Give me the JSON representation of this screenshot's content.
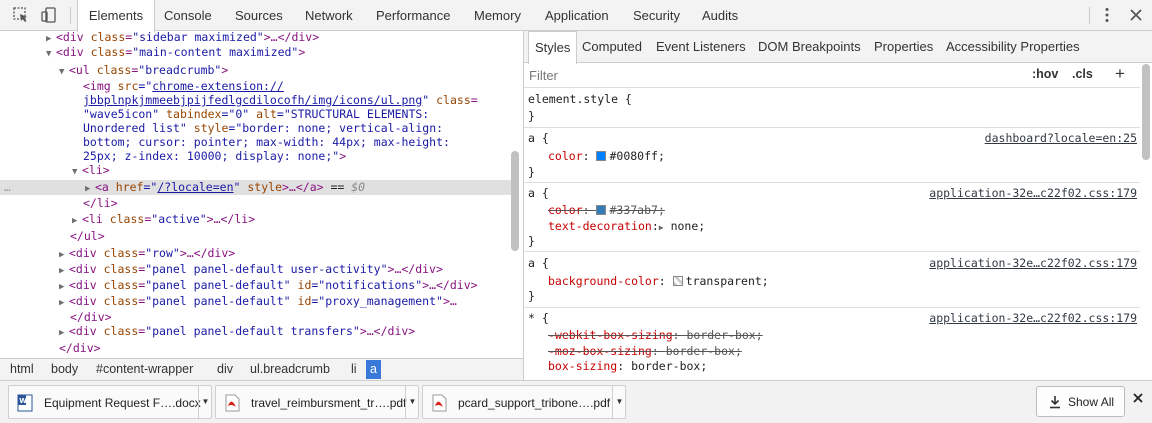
{
  "topbar": {
    "tabs": [
      "Elements",
      "Console",
      "Sources",
      "Network",
      "Performance",
      "Memory",
      "Application",
      "Security",
      "Audits"
    ],
    "active_tab": "Elements",
    "icons": [
      "inspect-element-icon",
      "device-toolbar-icon",
      "kebab-menu-icon",
      "close-icon"
    ]
  },
  "dom": {
    "l1": {
      "tag_open": "<div ",
      "attr": "class",
      "val": "\"sidebar maximized\"",
      "rest": ">…</div>"
    },
    "l2": {
      "tag_open": "<div ",
      "attr": "class",
      "val": "\"main-content maximized\"",
      "rest": ">"
    },
    "l3": {
      "tag_open": "<ul ",
      "attr": "class",
      "val": "\"breadcrumb\"",
      "rest": ">"
    },
    "l4": {
      "tag_open": "<img ",
      "attr": "src",
      "eq": "=\"",
      "link": "chrome-extension://"
    },
    "l5": {
      "link": "jbbplnpkjmmeebjpijfedlgcdilocofh/img/icons/ul.png",
      "close": "\" ",
      "attr": "class",
      "eq": "="
    },
    "l6": {
      "val": "\"wave5icon\" ",
      "attr": "tabindex",
      "val2": "=\"0\" ",
      "attr2": "alt",
      "val3": "=\"STRUCTURAL ELEMENTS:"
    },
    "l7": {
      "val": "Unordered list\" ",
      "attr": "style",
      "val2": "=\"border: none; vertical-align:"
    },
    "l8": {
      "val": "bottom; cursor: pointer; max-width: 44px; max-height:"
    },
    "l9": {
      "val": "25px; z-index: 10000; display: none;\"",
      "rest": ">"
    },
    "l10": {
      "tag": "<li>"
    },
    "l11": {
      "gutter": "…",
      "tag_open": "<a ",
      "attr": "href",
      "eq": "=\"",
      "link": "/?locale=en",
      "close": "\" ",
      "attr2": "style",
      "rest": ">…</a>",
      "eqsign": " == ",
      "dollar": "$0"
    },
    "l12": {
      "tag": "</li>"
    },
    "l13": {
      "tag_open": "<li ",
      "attr": "class",
      "val": "\"active\"",
      "rest": ">…</li>"
    },
    "l14": {
      "tag": "</ul>"
    },
    "l15": {
      "tag_open": "<div ",
      "attr": "class",
      "val": "\"row\"",
      "rest": ">…</div>"
    },
    "l16": {
      "tag_open": "<div ",
      "attr": "class",
      "val": "\"panel panel-default user-activity\"",
      "rest": ">…</div>"
    },
    "l17": {
      "tag_open": "<div ",
      "attr": "class",
      "val": "\"panel panel-default\" ",
      "attr2": "id",
      "val2": "=\"notifications\"",
      "rest": ">…</div>"
    },
    "l18": {
      "tag_open": "<div ",
      "attr": "class",
      "val": "\"panel panel-default\" ",
      "attr2": "id",
      "val2": "=\"proxy_management\"",
      "rest": ">…"
    },
    "l19": {
      "tag": "</div>"
    },
    "l20": {
      "tag_open": "<div ",
      "attr": "class",
      "val": "\"panel panel-default transfers\"",
      "rest": ">…</div>"
    },
    "l21": {
      "tag": "</div>"
    }
  },
  "breadcrumbs": [
    "html",
    "body",
    "#content-wrapper",
    "div",
    "ul.breadcrumb",
    "li",
    "a"
  ],
  "styles_tabs": [
    "Styles",
    "Computed",
    "Event Listeners",
    "DOM Breakpoints",
    "Properties",
    "Accessibility Properties"
  ],
  "filter": {
    "placeholder": "Filter",
    "hov": ":hov",
    "cls": ".cls",
    "plus": "+"
  },
  "rules": {
    "r0": {
      "selector": "element.style {",
      "close": "}"
    },
    "r1": {
      "selector": "a {",
      "source": "dashboard?locale=en:25",
      "prop": "color",
      "value": "#0080ff;",
      "swatch": "#0080ff",
      "close": "}"
    },
    "r2": {
      "selector": "a {",
      "source": "application-32e…c22f02.css:179",
      "prop": "color",
      "value": "#337ab7;",
      "swatch": "#337ab7",
      "prop2": "text-decoration",
      "value2": "none;",
      "close": "}"
    },
    "r3": {
      "selector": "a {",
      "source": "application-32e…c22f02.css:179",
      "prop": "background-color",
      "value": "transparent;",
      "close": "}"
    },
    "r4": {
      "selector": "* {",
      "source": "application-32e…c22f02.css:179",
      "p1": "-webkit-box-sizing",
      "v1": "border-box;",
      "p2": "-moz-box-sizing",
      "v2": "border-box;",
      "p3": "box-sizing",
      "v3": "border-box;"
    }
  },
  "downloads": {
    "items": [
      {
        "name": "Equipment Request F….docx",
        "type": "word"
      },
      {
        "name": "travel_reimbursment_tr….pdf",
        "type": "pdf"
      },
      {
        "name": "pcard_support_tribone….pdf",
        "type": "pdf"
      }
    ],
    "show_all": "Show All"
  }
}
